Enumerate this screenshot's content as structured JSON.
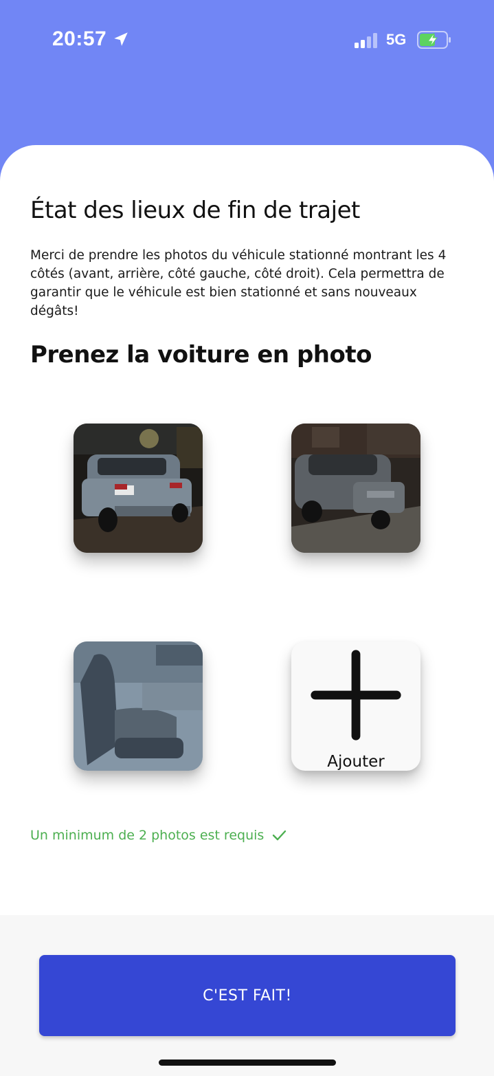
{
  "status_bar": {
    "time": "20:57",
    "network": "5G",
    "icons": [
      "location-arrow-icon",
      "signal-bars-icon",
      "battery-charging-icon"
    ]
  },
  "colors": {
    "header_bg": "#7186f5",
    "primary_button": "#3547d4",
    "success": "#4caf50",
    "battery_fill": "#5dd361"
  },
  "main": {
    "title": "État des lieux de fin de trajet",
    "description": "Merci de prendre les photos du véhicule stationné montrant les 4 côtés (avant, arrière, côté gauche, côté droit). Cela permettra de garantir que le véhicule est bien stationné et sans nouveaux dégâts!",
    "subtitle": "Prenez la voiture en photo",
    "photos": [
      {
        "subject": "car-rear-photo"
      },
      {
        "subject": "car-front-photo"
      },
      {
        "subject": "car-interior-photo"
      }
    ],
    "add_label": "Ajouter",
    "requirement_text": "Un minimum de 2 photos est requis"
  },
  "footer": {
    "done_label": "C'EST FAIT!"
  }
}
